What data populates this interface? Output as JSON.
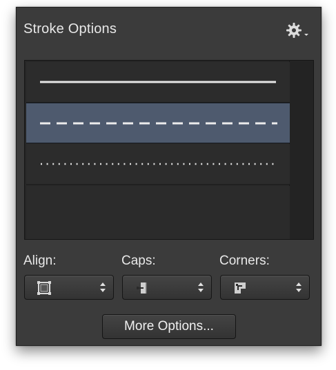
{
  "panel": {
    "title": "Stroke Options",
    "menu_icon": "gear-icon"
  },
  "stroke_styles": [
    {
      "name": "solid",
      "selected": false
    },
    {
      "name": "dashed",
      "selected": true
    },
    {
      "name": "dotted",
      "selected": false
    }
  ],
  "align": {
    "label": "Align:",
    "icon": "align-center-stroke-icon"
  },
  "caps": {
    "label": "Caps:",
    "icon": "butt-cap-icon"
  },
  "corners": {
    "label": "Corners:",
    "icon": "miter-corner-icon"
  },
  "more_options": {
    "label": "More Options..."
  },
  "colors": {
    "panel_bg": "#3b3b3b",
    "selection": "#4e5a6e",
    "line": "#e6e6e6"
  }
}
